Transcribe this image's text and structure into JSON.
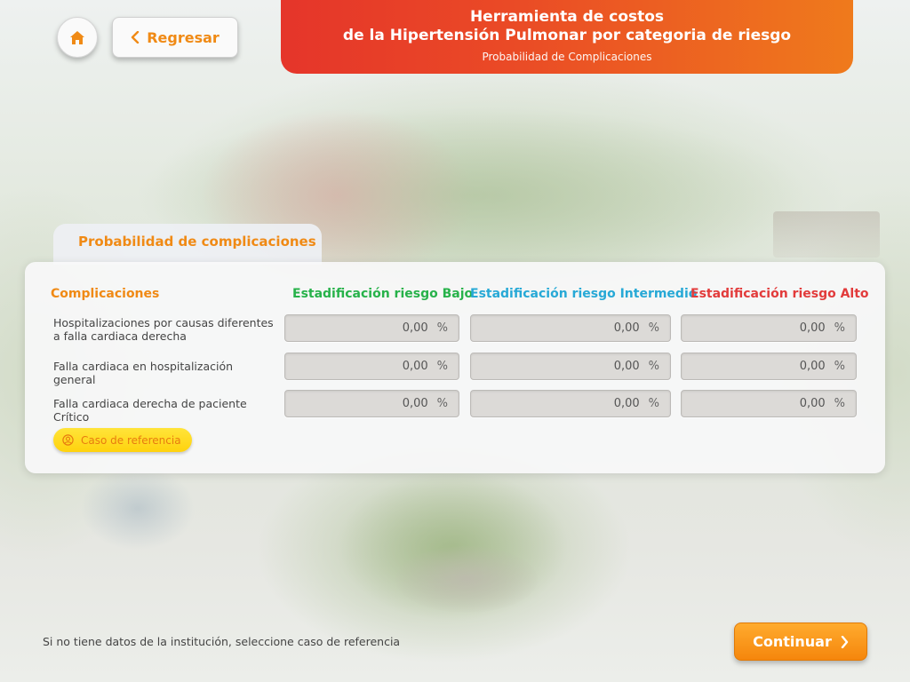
{
  "nav": {
    "home_icon": "home-icon",
    "back_label": "Regresar",
    "back_icon": "chevron-left-icon"
  },
  "header": {
    "title_line1": "Herramienta de costos",
    "title_line2": "de la Hipertensión Pulmonar por categoria de riesgo",
    "subtitle": "Probabilidad de Complicaciones",
    "gradient_start": "#e5352a",
    "gradient_end": "#ef7a1c"
  },
  "panel": {
    "tab_label": "Probabilidad de complicaciones",
    "columns": {
      "label": "Complicaciones",
      "low": "Estadificación riesgo Bajo",
      "intermediate": "Estadificación riesgo Intermedio",
      "high": "Estadificación riesgo Alto"
    },
    "column_colors": {
      "label": "#f08a15",
      "low": "#27b24a",
      "intermediate": "#27a9d6",
      "high": "#e23b3b"
    },
    "rows": [
      {
        "label": "Hospitalizaciones por causas diferentes a falla cardiaca derecha",
        "low": "0,00",
        "intermediate": "0,00",
        "high": "0,00"
      },
      {
        "label": "Falla cardiaca en hospitalización general",
        "low": "0,00",
        "intermediate": "0,00",
        "high": "0,00"
      },
      {
        "label": "Falla cardiaca derecha de paciente Crítico",
        "low": "0,00",
        "intermediate": "0,00",
        "high": "0,00"
      }
    ],
    "unit": "%",
    "reference_button": "Caso de referencia",
    "reference_icon": "user-circle-icon"
  },
  "footer": {
    "note": "Si no tiene datos de la institución, seleccione caso de referencia",
    "continue_label": "Continuar",
    "continue_icon": "chevron-right-icon"
  }
}
